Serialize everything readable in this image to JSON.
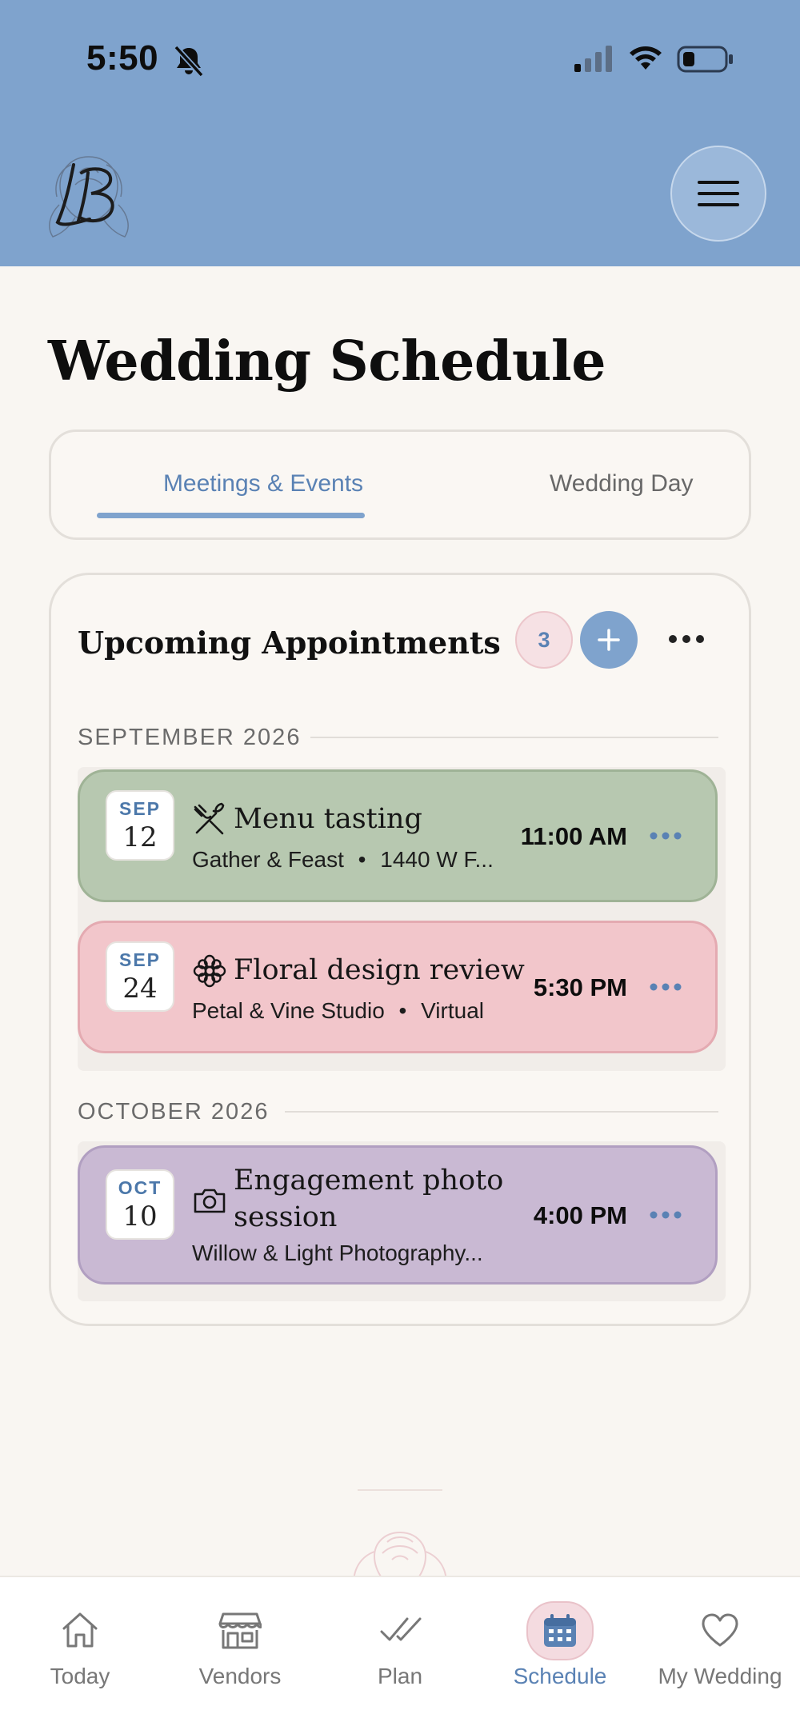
{
  "status_bar": {
    "time": "5:50"
  },
  "header": {
    "logo_alt": "LB"
  },
  "page_title": "Wedding Schedule",
  "tabs": [
    {
      "label": "Meetings & Events",
      "active": true
    },
    {
      "label": "Wedding Day",
      "active": false
    }
  ],
  "appointments_card": {
    "title": "Upcoming Appointments",
    "count": "3"
  },
  "months": [
    {
      "label": "SEPTEMBER 2026",
      "appointments": [
        {
          "date_month": "SEP",
          "date_day": "12",
          "icon": "utensils-icon",
          "title": "Menu tasting",
          "vendor": "Gather & Feast",
          "location": "1440 W F...",
          "time": "11:00 AM",
          "color": "#b7c8b0"
        },
        {
          "date_month": "SEP",
          "date_day": "24",
          "icon": "flower-icon",
          "title": "Floral design review",
          "vendor": "Petal & Vine Studio",
          "location": "Virtual",
          "time": "5:30 PM",
          "color": "#f2c6cb"
        }
      ]
    },
    {
      "label": "OCTOBER 2026",
      "appointments": [
        {
          "date_month": "OCT",
          "date_day": "10",
          "icon": "camera-icon",
          "title_line1": "Engagement photo",
          "title_line2": "session",
          "vendor": "Willow & Light Photography...",
          "time": "4:00 PM",
          "color": "#c9b9d3"
        }
      ]
    }
  ],
  "separator": "•",
  "bottom_nav": [
    {
      "label": "Today",
      "icon": "home-icon",
      "active": false
    },
    {
      "label": "Vendors",
      "icon": "store-icon",
      "active": false
    },
    {
      "label": "Plan",
      "icon": "double-check-icon",
      "active": false
    },
    {
      "label": "Schedule",
      "icon": "calendar-icon",
      "active": true
    },
    {
      "label": "My Wedding",
      "icon": "heart-icon",
      "active": false
    }
  ],
  "colors": {
    "header": "#7fa3cd",
    "accent": "#5a82b4",
    "background": "#f9f6f2"
  }
}
